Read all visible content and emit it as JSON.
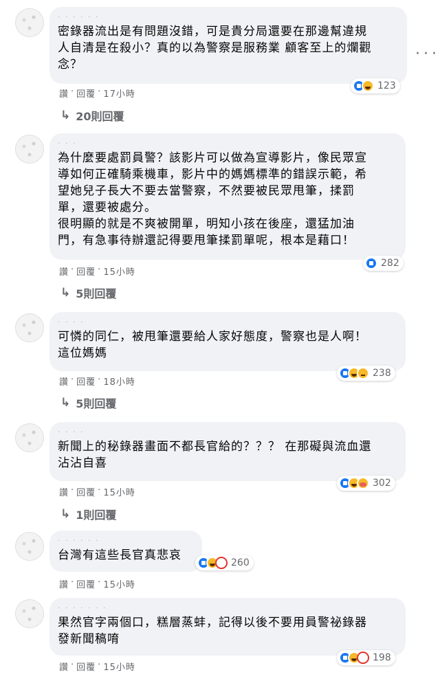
{
  "comments": [
    {
      "text": "密錄器流出是有問題沒錯，可是貴分局還要在那邊幫違規\n人自清是在殺小？真的以為警察是服務業 顧客至上的爛觀\n念？",
      "reaction_count": "123",
      "reactions": [
        "like",
        "haha"
      ],
      "actions": {
        "like": "讚",
        "reply": "回覆",
        "time": "17小時"
      },
      "replies": "20則回覆"
    },
    {
      "text": "為什麼要處罰員警？該影片可以做為宣導影片，像民眾宣\n導如何正確騎乘機車，影片中的媽媽標準的錯誤示範，希\n望她兒子長大不要去當警察，不然要被民眾甩筆，揉罰\n單，還要被處分。\n很明顯的就是不爽被開單，明知小孩在後座，還猛加油\n門，有急事待辦還記得要甩筆揉罰單呢，根本是藉口！",
      "reaction_count": "282",
      "reactions": [
        "like"
      ],
      "actions": {
        "like": "讚",
        "reply": "回覆",
        "time": "15小時"
      },
      "replies": "5則回覆"
    },
    {
      "text": "可憐的同仁，被甩筆還要給人家好態度，警察也是人啊！\n這位媽媽",
      "reaction_count": "238",
      "reactions": [
        "like",
        "haha",
        "sad"
      ],
      "actions": {
        "like": "讚",
        "reply": "回覆",
        "time": "18小時"
      },
      "replies": "5則回覆"
    },
    {
      "text": "新聞上的秘錄器畫面不都長官給的？？？ 在那礙與流血還\n沾沾自喜",
      "reaction_count": "302",
      "reactions": [
        "like",
        "haha",
        "care"
      ],
      "actions": {
        "like": "讚",
        "reply": "回覆",
        "time": "15小時"
      },
      "replies": "1則回覆"
    },
    {
      "text": "台灣有這些長官真悲哀",
      "reaction_count": "260",
      "reactions": [
        "like",
        "haha",
        "love"
      ],
      "actions": {
        "like": "讚",
        "reply": "回覆",
        "time": "15小時"
      }
    },
    {
      "text": "果然官字兩個口，糕層蒸蚌，記得以後不要用員警祕錄器\n發新聞稿唷",
      "reaction_count": "198",
      "reactions": [
        "like",
        "haha",
        "love"
      ],
      "actions": {
        "like": "讚",
        "reply": "回覆",
        "time": "15小時"
      }
    }
  ],
  "more_icon": "ellipsis-icon",
  "colors": {
    "bubble": "#f0f2f5",
    "meta": "#65676b",
    "like": "#1877f2"
  }
}
